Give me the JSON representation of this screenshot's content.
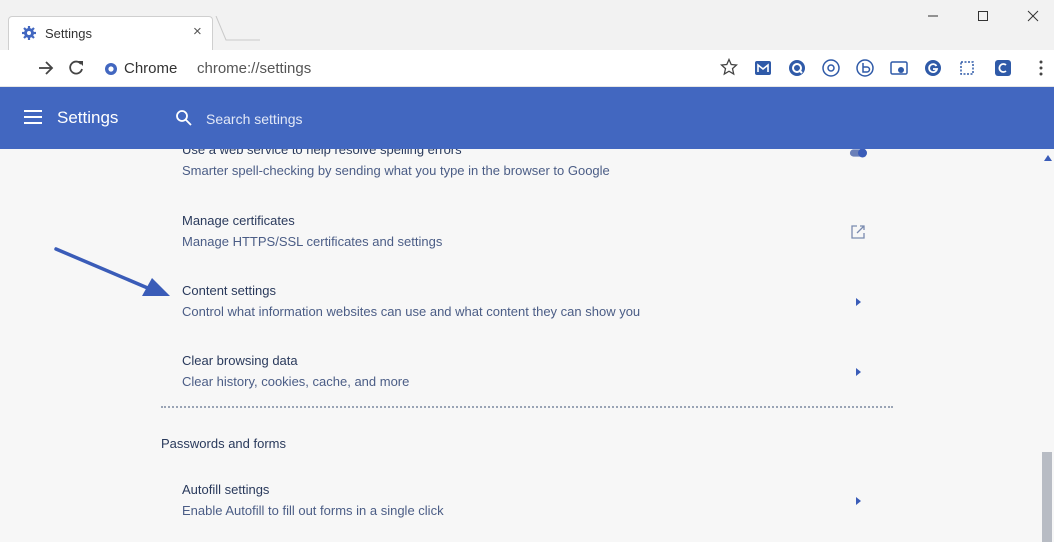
{
  "browser": {
    "tab_title": "Settings",
    "tab_close_icon": "×",
    "site_name": "Chrome",
    "url": "chrome://settings"
  },
  "header": {
    "title": "Settings",
    "search_placeholder": "Search settings"
  },
  "rows": [
    {
      "title": "Use a web service to help resolve spelling errors",
      "subtitle": "Smarter spell-checking by sending what you type in the browser to Google",
      "action": "toggle-icon"
    },
    {
      "title": "Manage certificates",
      "subtitle": "Manage HTTPS/SSL certificates and settings",
      "action": "external-link-icon"
    },
    {
      "title": "Content settings",
      "subtitle": "Control what information websites can use and what content they can show you",
      "action": "chevron-right-icon"
    },
    {
      "title": "Clear browsing data",
      "subtitle": "Clear history, cookies, cache, and more",
      "action": "chevron-right-icon"
    },
    {
      "title": "Autofill settings",
      "subtitle": "Enable Autofill to fill out forms in a single click",
      "action": "chevron-right-icon"
    }
  ],
  "sections": {
    "passwords_title": "Passwords and forms"
  },
  "colors": {
    "header_bg": "#4267c0",
    "accent_arrow": "#3a5cb8",
    "page_bg": "#f7f7f7"
  }
}
